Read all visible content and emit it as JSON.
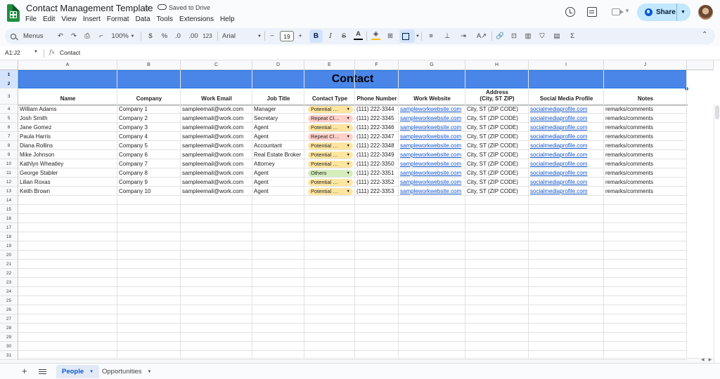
{
  "header": {
    "doc_title": "Contact Management Template",
    "saved_status": "Saved to Drive",
    "menu": [
      "File",
      "Edit",
      "View",
      "Insert",
      "Format",
      "Data",
      "Tools",
      "Extensions",
      "Help"
    ],
    "share_label": "Share"
  },
  "toolbar": {
    "menus_label": "Menus",
    "zoom": "100%",
    "currency": "$",
    "percent": "%",
    "dec_decrease": ".0",
    "dec_increase": ".00",
    "number_format": "123",
    "font": "Arial",
    "font_size": "19",
    "bold": "B",
    "italic": "I",
    "text_color": "A",
    "sigma": "Σ"
  },
  "formula_bar": {
    "name_box": "A1:J2",
    "fx": "fx",
    "value": "Contact"
  },
  "grid": {
    "columns": [
      "A",
      "B",
      "C",
      "D",
      "E",
      "F",
      "G",
      "H",
      "I",
      "J"
    ],
    "row_numbers": [
      "1",
      "2",
      "3",
      "4",
      "5",
      "6",
      "7",
      "8",
      "9",
      "10",
      "11",
      "12",
      "13",
      "14",
      "15",
      "16",
      "17",
      "18",
      "19",
      "20",
      "21",
      "22",
      "23",
      "24",
      "25",
      "26",
      "27",
      "28",
      "29",
      "30",
      "31"
    ],
    "title": "Contact",
    "headers": [
      "Name",
      "Company",
      "Work Email",
      "Job Title",
      "Contact Type",
      "Phone Number",
      "Work Website",
      "Address\n(City, ST ZIP)",
      "Social Media Profile",
      "Notes"
    ],
    "rows": [
      [
        "William Adams",
        "Company 1",
        "sampleemail@work.com",
        "Manager",
        "Potential Client",
        "(111) 222-3344",
        "sampleworkwebsite.com",
        "City, ST (ZIP CODE)",
        "socialmediaprofile.com",
        "remarks/comments"
      ],
      [
        "Josh Smith",
        "Company 2",
        "sampleemail@work.com",
        "Secretary",
        "Repeat Client",
        "(111) 222-3345",
        "sampleworkwebsite.com",
        "City, ST (ZIP CODE)",
        "socialmediaprofile.com",
        "remarks/comments"
      ],
      [
        "Jane Gomez",
        "Company 3",
        "sampleemail@work.com",
        "Agent",
        "Potential Client",
        "(111) 222-3346",
        "sampleworkwebsite.com",
        "City, ST (ZIP CODE)",
        "socialmediaprofile.com",
        "remarks/comments"
      ],
      [
        "Paula Harris",
        "Company 4",
        "sampleemail@work.com",
        "Agent",
        "Repeat Client",
        "(111) 222-3347",
        "sampleworkwebsite.com",
        "City, ST (ZIP CODE)",
        "socialmediaprofile.com",
        "remarks/comments"
      ],
      [
        "Diana Rollins",
        "Company 5",
        "sampleemail@work.com",
        "Accountant",
        "Potential Client",
        "(111) 222-3348",
        "sampleworkwebsite.com",
        "City, ST (ZIP CODE)",
        "socialmediaprofile.com",
        "remarks/comments"
      ],
      [
        "Mike Johnson",
        "Company 6",
        "sampleemail@work.com",
        "Real Estate Broker",
        "Potential Client",
        "(111) 222-3349",
        "sampleworkwebsite.com",
        "City, ST (ZIP CODE)",
        "socialmediaprofile.com",
        "remarks/comments"
      ],
      [
        "Kathlyn Wheatley",
        "Company 7",
        "sampleemail@work.com",
        "Attorney",
        "Potential Client",
        "(111) 222-3350",
        "sampleworkwebsite.com",
        "City, ST (ZIP CODE)",
        "socialmediaprofile.com",
        "remarks/comments"
      ],
      [
        "George Stabler",
        "Company 8",
        "sampleemail@work.com",
        "Agent",
        "Others",
        "(111) 222-3351",
        "sampleworkwebsite.com",
        "City, ST (ZIP CODE)",
        "socialmediaprofile.com",
        "remarks/comments"
      ],
      [
        "Lilian Roxas",
        "Company 9",
        "sampleemail@work.com",
        "Agent",
        "Potential Client",
        "(111) 222-3352",
        "sampleworkwebsite.com",
        "City, ST (ZIP CODE)",
        "socialmediaprofile.com",
        "remarks/comments"
      ],
      [
        "Keith Brown",
        "Company 10",
        "sampleemail@work.com",
        "Agent",
        "Potential Client",
        "(111) 222-3353",
        "sampleworkwebsite.com",
        "City, ST (ZIP CODE)",
        "socialmediaprofile.com",
        "remarks/comments"
      ]
    ],
    "chip_colors": {
      "Potential Client": "#ffe5a0",
      "Repeat Client": "#ffcfc9",
      "Others": "#d4edbc"
    }
  },
  "tabs": {
    "sheets": [
      "People",
      "Opportunities"
    ],
    "active": "People"
  },
  "colors": {
    "title_band": "#4a86e8",
    "accent": "#0b57d0",
    "link": "#1155cc"
  }
}
